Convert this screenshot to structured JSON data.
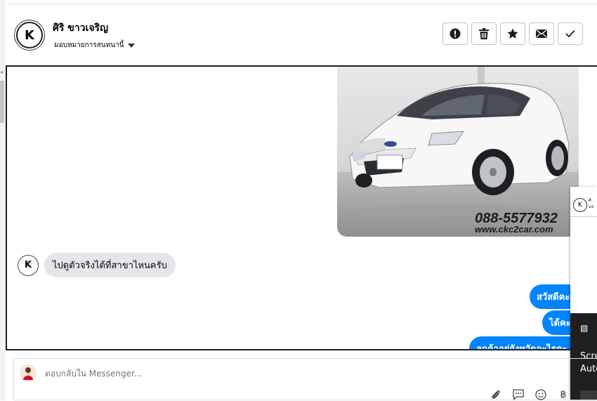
{
  "header": {
    "contact_name": "ศิริ ขาวเจริญ",
    "assign_label": "มอบหมายการสนทนานี้",
    "avatar_letter": "K",
    "actions": [
      {
        "name": "report-button",
        "icon": "exclamation-icon"
      },
      {
        "name": "delete-button",
        "icon": "trash-icon"
      },
      {
        "name": "star-button",
        "icon": "star-icon"
      },
      {
        "name": "mark-unread-button",
        "icon": "envelope-icon"
      },
      {
        "name": "done-button",
        "icon": "check-icon"
      }
    ]
  },
  "chat": {
    "car_image": {
      "phone": "088-5577932",
      "website": "www.ckc2car.com"
    },
    "incoming_message": "ไปดูตัวจริงได้ที่สาขาไหนครับ",
    "outgoing_messages": [
      "สวัสดีคะ",
      "ได้คะ",
      "ลูกค้าอยู่จังหวัดอะไรคะ"
    ]
  },
  "popup": {
    "text_line1": "ศิ",
    "text_line2": "มอ"
  },
  "toast": {
    "line1": "Scre",
    "line2": "Auto"
  },
  "composer": {
    "placeholder": "ตอบกลับใน Messenger...",
    "tools": [
      "paperclip-icon",
      "chat-icon",
      "emoji-icon",
      "baht-icon"
    ],
    "baht_symbol": "฿"
  },
  "colors": {
    "accent": "#0084ff",
    "incoming_bubble": "#e4e6eb"
  }
}
